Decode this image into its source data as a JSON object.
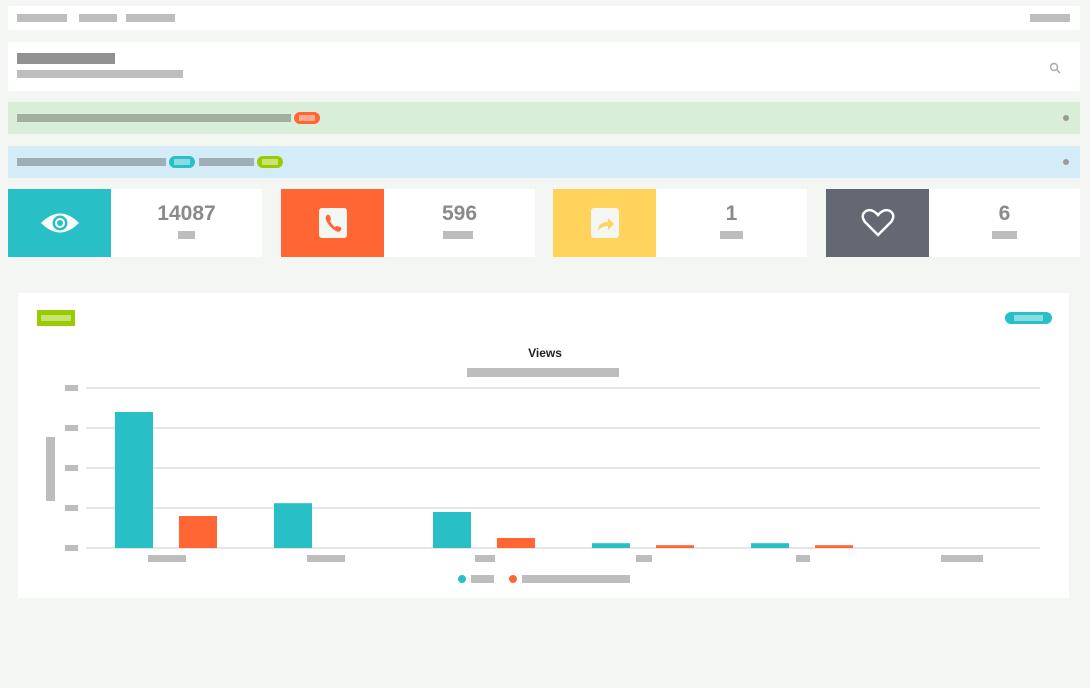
{
  "stats": [
    {
      "icon": "eye-icon",
      "value": "14087",
      "color": "#28bfc6"
    },
    {
      "icon": "phone-icon",
      "value": "596",
      "color": "#ff6633"
    },
    {
      "icon": "share-icon",
      "value": "1",
      "color": "#ffd35c"
    },
    {
      "icon": "heart-icon",
      "value": "6",
      "color": "#636873"
    }
  ],
  "chart_data": {
    "type": "bar",
    "title": "Views",
    "categories": [
      "",
      "",
      "",
      "",
      "",
      ""
    ],
    "series": [
      {
        "name": "",
        "color": "#28bfc6",
        "values": [
          3.4,
          1.12,
          0.9,
          0.12,
          0.12,
          0
        ]
      },
      {
        "name": "",
        "color": "#ff6633",
        "values": [
          0.8,
          0,
          0.25,
          0.07,
          0.07,
          0
        ]
      }
    ],
    "ylim": [
      0,
      4
    ],
    "grid": true,
    "legend": "bottom"
  }
}
